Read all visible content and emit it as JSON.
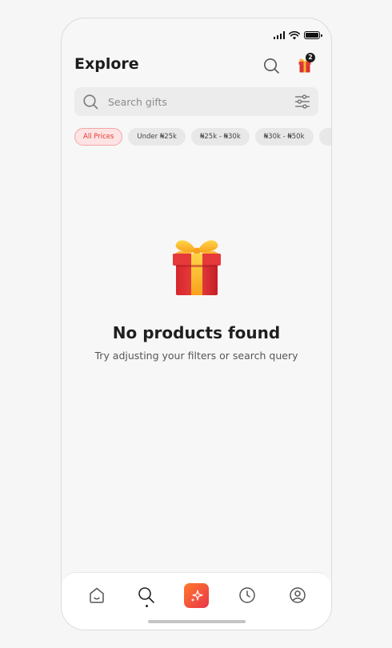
{
  "header": {
    "title": "Explore",
    "cart_count": "2"
  },
  "search": {
    "placeholder": "Search gifts"
  },
  "filters": {
    "chips": [
      {
        "label": "All Prices",
        "active": true
      },
      {
        "label": "Under ₦25k",
        "active": false
      },
      {
        "label": "₦25k - ₦30k",
        "active": false
      },
      {
        "label": "₦30k - ₦50k",
        "active": false
      },
      {
        "label": "",
        "active": false
      }
    ]
  },
  "empty_state": {
    "title": "No products found",
    "subtitle": "Try adjusting your filters or search query"
  },
  "nav": {
    "items": [
      "home-icon",
      "search-icon",
      "sparkle-icon",
      "clock-icon",
      "profile-icon"
    ],
    "active_index": 1
  },
  "colors": {
    "accent": "#e8354a",
    "accent_orange": "#ff7a2b",
    "chip_active_bg": "#fde3e3"
  }
}
